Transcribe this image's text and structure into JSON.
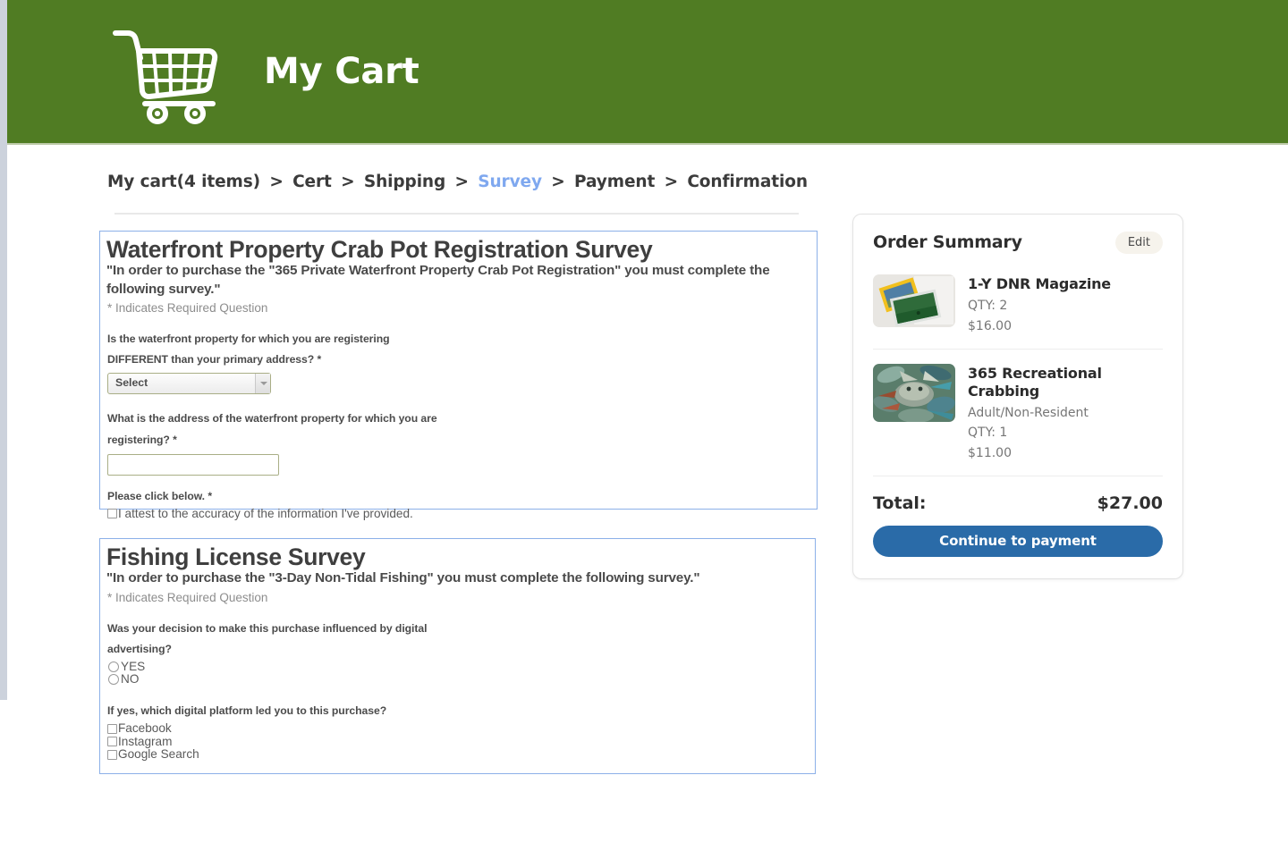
{
  "header": {
    "title": "My Cart",
    "logo_icon": "shopping-cart-icon",
    "background_color": "#507c23"
  },
  "breadcrumb": {
    "items": [
      {
        "label": "My cart(4 items)",
        "active": false
      },
      {
        "label": "Cert",
        "active": false
      },
      {
        "label": "Shipping",
        "active": false
      },
      {
        "label": "Survey",
        "active": true
      },
      {
        "label": "Payment",
        "active": false
      },
      {
        "label": "Confirmation",
        "active": false
      }
    ],
    "separator": ">",
    "active_color": "#7fa8ef"
  },
  "surveys": [
    {
      "title": "Waterfront Property Crab Pot Registration Survey",
      "intro": "\"In order to purchase the \"365 Private Waterfront Property Crab Pot Registration\" you must complete the following survey.\"",
      "required_note": "* Indicates Required Question",
      "questions": {
        "q1_line1": "Is the waterfront property for which you are registering",
        "q1_line2": "DIFFERENT than your primary address? *",
        "q1_select_value": "Select",
        "q2_line1": "What is the address of the waterfront property for which you are",
        "q2_line2": "registering? *",
        "q2_input_value": "",
        "q2_input_placeholder": "",
        "q3_label": "Please click below. *",
        "q3_checkbox_label": "I attest to the accuracy of the information I've provided."
      }
    },
    {
      "title": "Fishing License Survey",
      "intro": "\"In order to purchase the \"3-Day Non-Tidal Fishing\" you must complete the following survey.\"",
      "required_note": "* Indicates Required Question",
      "questions": {
        "q1_line1": "Was your decision to make this purchase influenced by digital",
        "q1_line2": "advertising?",
        "q1_option_yes": "YES",
        "q1_option_no": "NO",
        "q2_label": "If yes, which digital platform led you to this purchase?",
        "q2_option_facebook": "Facebook",
        "q2_option_instagram": "Instagram",
        "q2_option_google": "Google Search"
      }
    }
  ],
  "order_summary": {
    "title": "Order Summary",
    "edit_label": "Edit",
    "items": [
      {
        "thumb_icon": "magazine-thumbnail",
        "name": "1-Y DNR Magazine",
        "subtitle": "",
        "qty": "QTY: 2",
        "price": "$16.00"
      },
      {
        "thumb_icon": "crab-thumbnail",
        "name": "365 Recreational Crabbing",
        "subtitle": "Adult/Non-Resident",
        "qty": "QTY: 1",
        "price": "$11.00"
      }
    ],
    "total_label": "Total:",
    "total_value": "$27.00",
    "continue_label": "Continue to payment",
    "continue_color": "#2a6ba8"
  }
}
